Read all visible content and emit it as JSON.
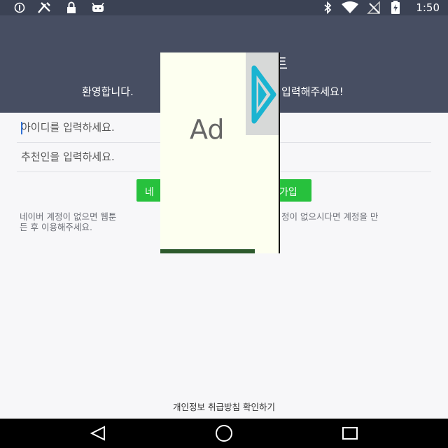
{
  "status_bar": {
    "time": "1:50",
    "icons": [
      "sync-icon",
      "tools-icon",
      "lock-icon",
      "android-icon",
      "bluetooth-icon",
      "wifi-icon",
      "no-signal-icon",
      "battery-icon"
    ]
  },
  "header": {
    "logo_fragment": "트",
    "welcome_left": "환영합니다. ",
    "welcome_right": "입력해주세요!"
  },
  "form": {
    "id_placeholder": "아이디를 입력하세요.",
    "referrer_placeholder": "추천인을 입력하세요.",
    "signup_left": "네",
    "signup_right": "가입",
    "notice_left_1": "네이버 계정이 없으면 웹툰",
    "notice_right_1": "정이 없으시다면 계정을 만",
    "notice_line_2": "든 후 이용해주세요.",
    "privacy_link": "개인정보 취급방침 확인하기"
  },
  "ad": {
    "label": "Ad"
  },
  "colors": {
    "header_bg": "#474e62",
    "status_bg": "#3b4254",
    "accent_green": "#27c13d",
    "ad_play": "#1ab4d1"
  }
}
